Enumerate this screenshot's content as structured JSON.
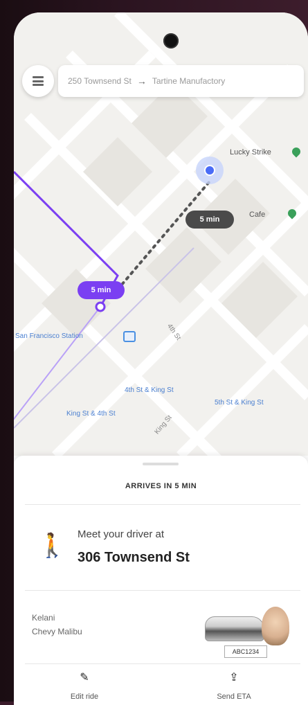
{
  "status_bar": {},
  "search": {
    "origin": "250 Townsend St",
    "destination": "Tartine Manufactory"
  },
  "map": {
    "driver_eta_pill": "5 min",
    "walk_eta_pill": "5 min",
    "places": [
      {
        "name": "Lucky Strike"
      },
      {
        "name": "Cafe"
      }
    ],
    "transit": [
      {
        "name": "San Francisco Station"
      },
      {
        "name": "4th St & King St"
      },
      {
        "name": "King St & 4th St"
      },
      {
        "name": "5th St & King St"
      }
    ],
    "streets": [
      {
        "name": "4th St"
      },
      {
        "name": "King St"
      }
    ]
  },
  "sheet": {
    "arrives_text": "ARRIVES IN 5 MIN",
    "meet_label": "Meet your driver at",
    "meet_address": "306 Townsend St",
    "driver_name": "Kelani",
    "car_model": "Chevy Malibu",
    "plate": "ABC1234",
    "actions": [
      {
        "label": "Edit ride",
        "icon": "pencil-icon"
      },
      {
        "label": "Send ETA",
        "icon": "share-icon"
      }
    ]
  },
  "colors": {
    "walk_route": "#7b3ff2",
    "driver_pill": "#4a4a4a",
    "driver_dot": "#4a6cf7",
    "pin": "#3aa05a"
  }
}
